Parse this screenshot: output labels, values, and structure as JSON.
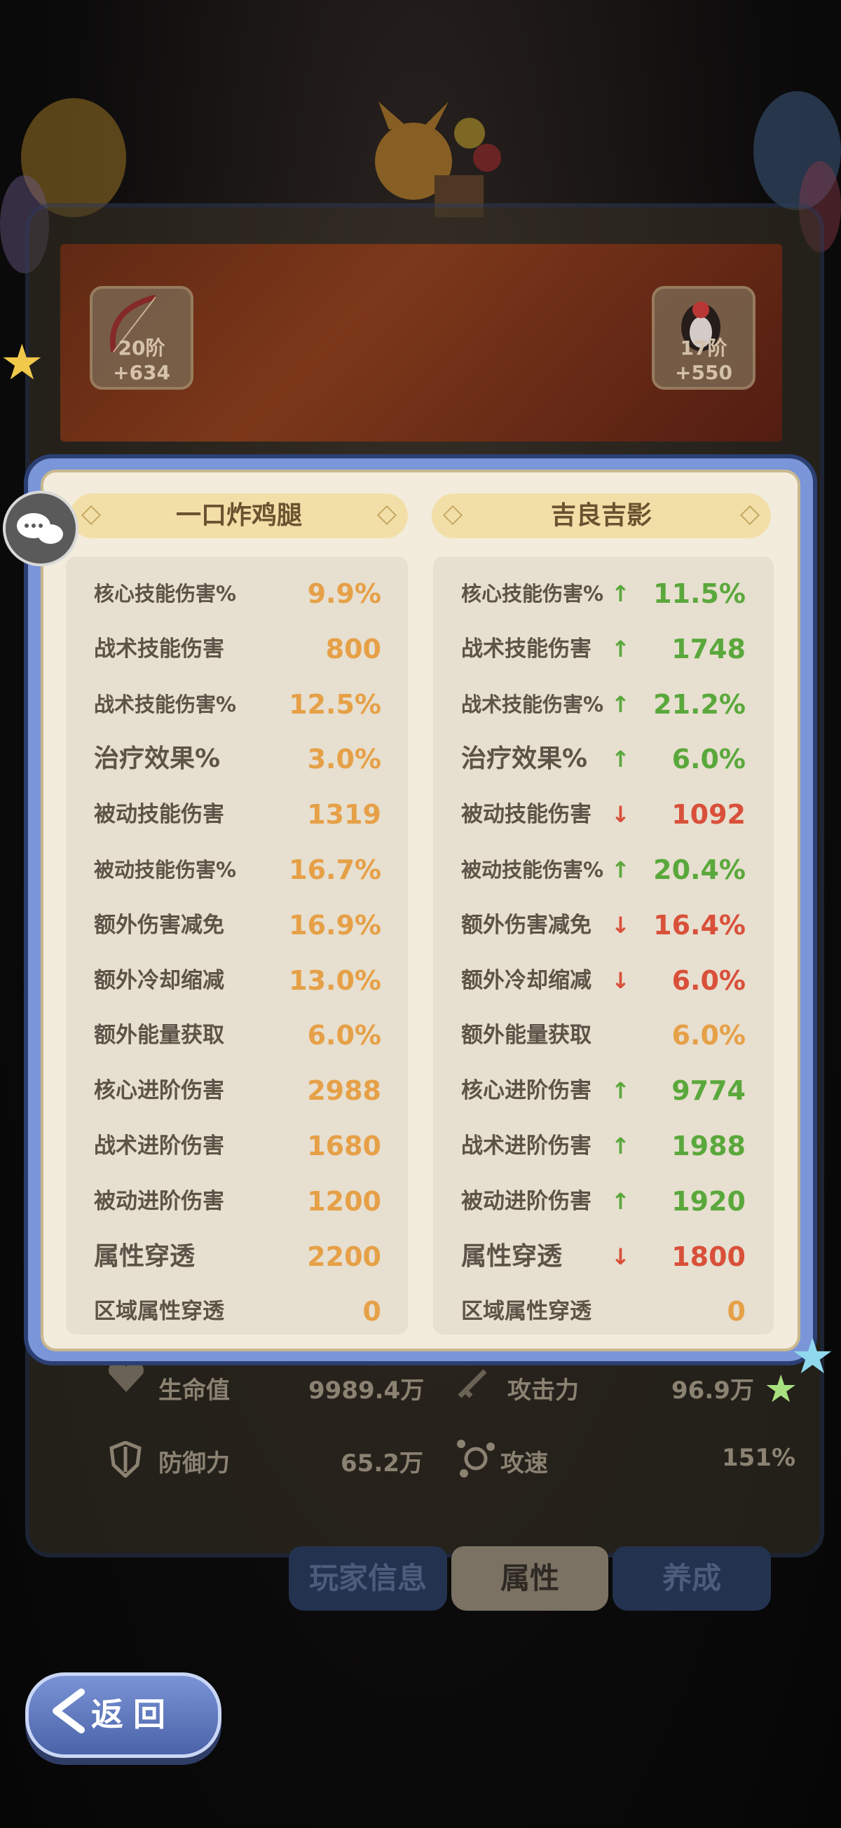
{
  "background": {
    "left_equipment": {
      "label": "20阶+634"
    },
    "right_equipment": {
      "label": "17阶+550"
    },
    "stats": {
      "row1_left": {
        "label": "生命值",
        "value": "9989.4万"
      },
      "row1_right": {
        "label": "攻击力",
        "value": "96.9万"
      },
      "row2_left": {
        "label": "防御力",
        "value": "65.2万"
      },
      "row2_right": {
        "label": "攻速",
        "value": "151%"
      }
    }
  },
  "tabs": [
    {
      "label": "玩家信息"
    },
    {
      "label": "属性"
    },
    {
      "label": "养成"
    }
  ],
  "back_button": {
    "label": "返回"
  },
  "colors": {
    "neutral_value": "#e6a047",
    "increase": "#5aa83c",
    "decrease": "#d9503a"
  },
  "comparison": {
    "left_player": {
      "name": "一口炸鸡腿"
    },
    "right_player": {
      "name": "吉良吉影"
    },
    "rows": [
      {
        "label": "核心技能伤害%",
        "left": "9.9%",
        "right": "11.5%",
        "trend": "up"
      },
      {
        "label": "战术技能伤害",
        "left": "800",
        "right": "1748",
        "trend": "up"
      },
      {
        "label": "战术技能伤害%",
        "left": "12.5%",
        "right": "21.2%",
        "trend": "up"
      },
      {
        "label": "治疗效果%",
        "left": "3.0%",
        "right": "6.0%",
        "trend": "up"
      },
      {
        "label": "被动技能伤害",
        "left": "1319",
        "right": "1092",
        "trend": "down"
      },
      {
        "label": "被动技能伤害%",
        "left": "16.7%",
        "right": "20.4%",
        "trend": "up"
      },
      {
        "label": "额外伤害减免",
        "left": "16.9%",
        "right": "16.4%",
        "trend": "down"
      },
      {
        "label": "额外冷却缩减",
        "left": "13.0%",
        "right": "6.0%",
        "trend": "down"
      },
      {
        "label": "额外能量获取",
        "left": "6.0%",
        "right": "6.0%",
        "trend": "same"
      },
      {
        "label": "核心进阶伤害",
        "left": "2988",
        "right": "9774",
        "trend": "up"
      },
      {
        "label": "战术进阶伤害",
        "left": "1680",
        "right": "1988",
        "trend": "up"
      },
      {
        "label": "被动进阶伤害",
        "left": "1200",
        "right": "1920",
        "trend": "up"
      },
      {
        "label": "属性穿透",
        "left": "2200",
        "right": "1800",
        "trend": "down"
      },
      {
        "label": "区域属性穿透",
        "left": "0",
        "right": "0",
        "trend": "same"
      }
    ]
  }
}
